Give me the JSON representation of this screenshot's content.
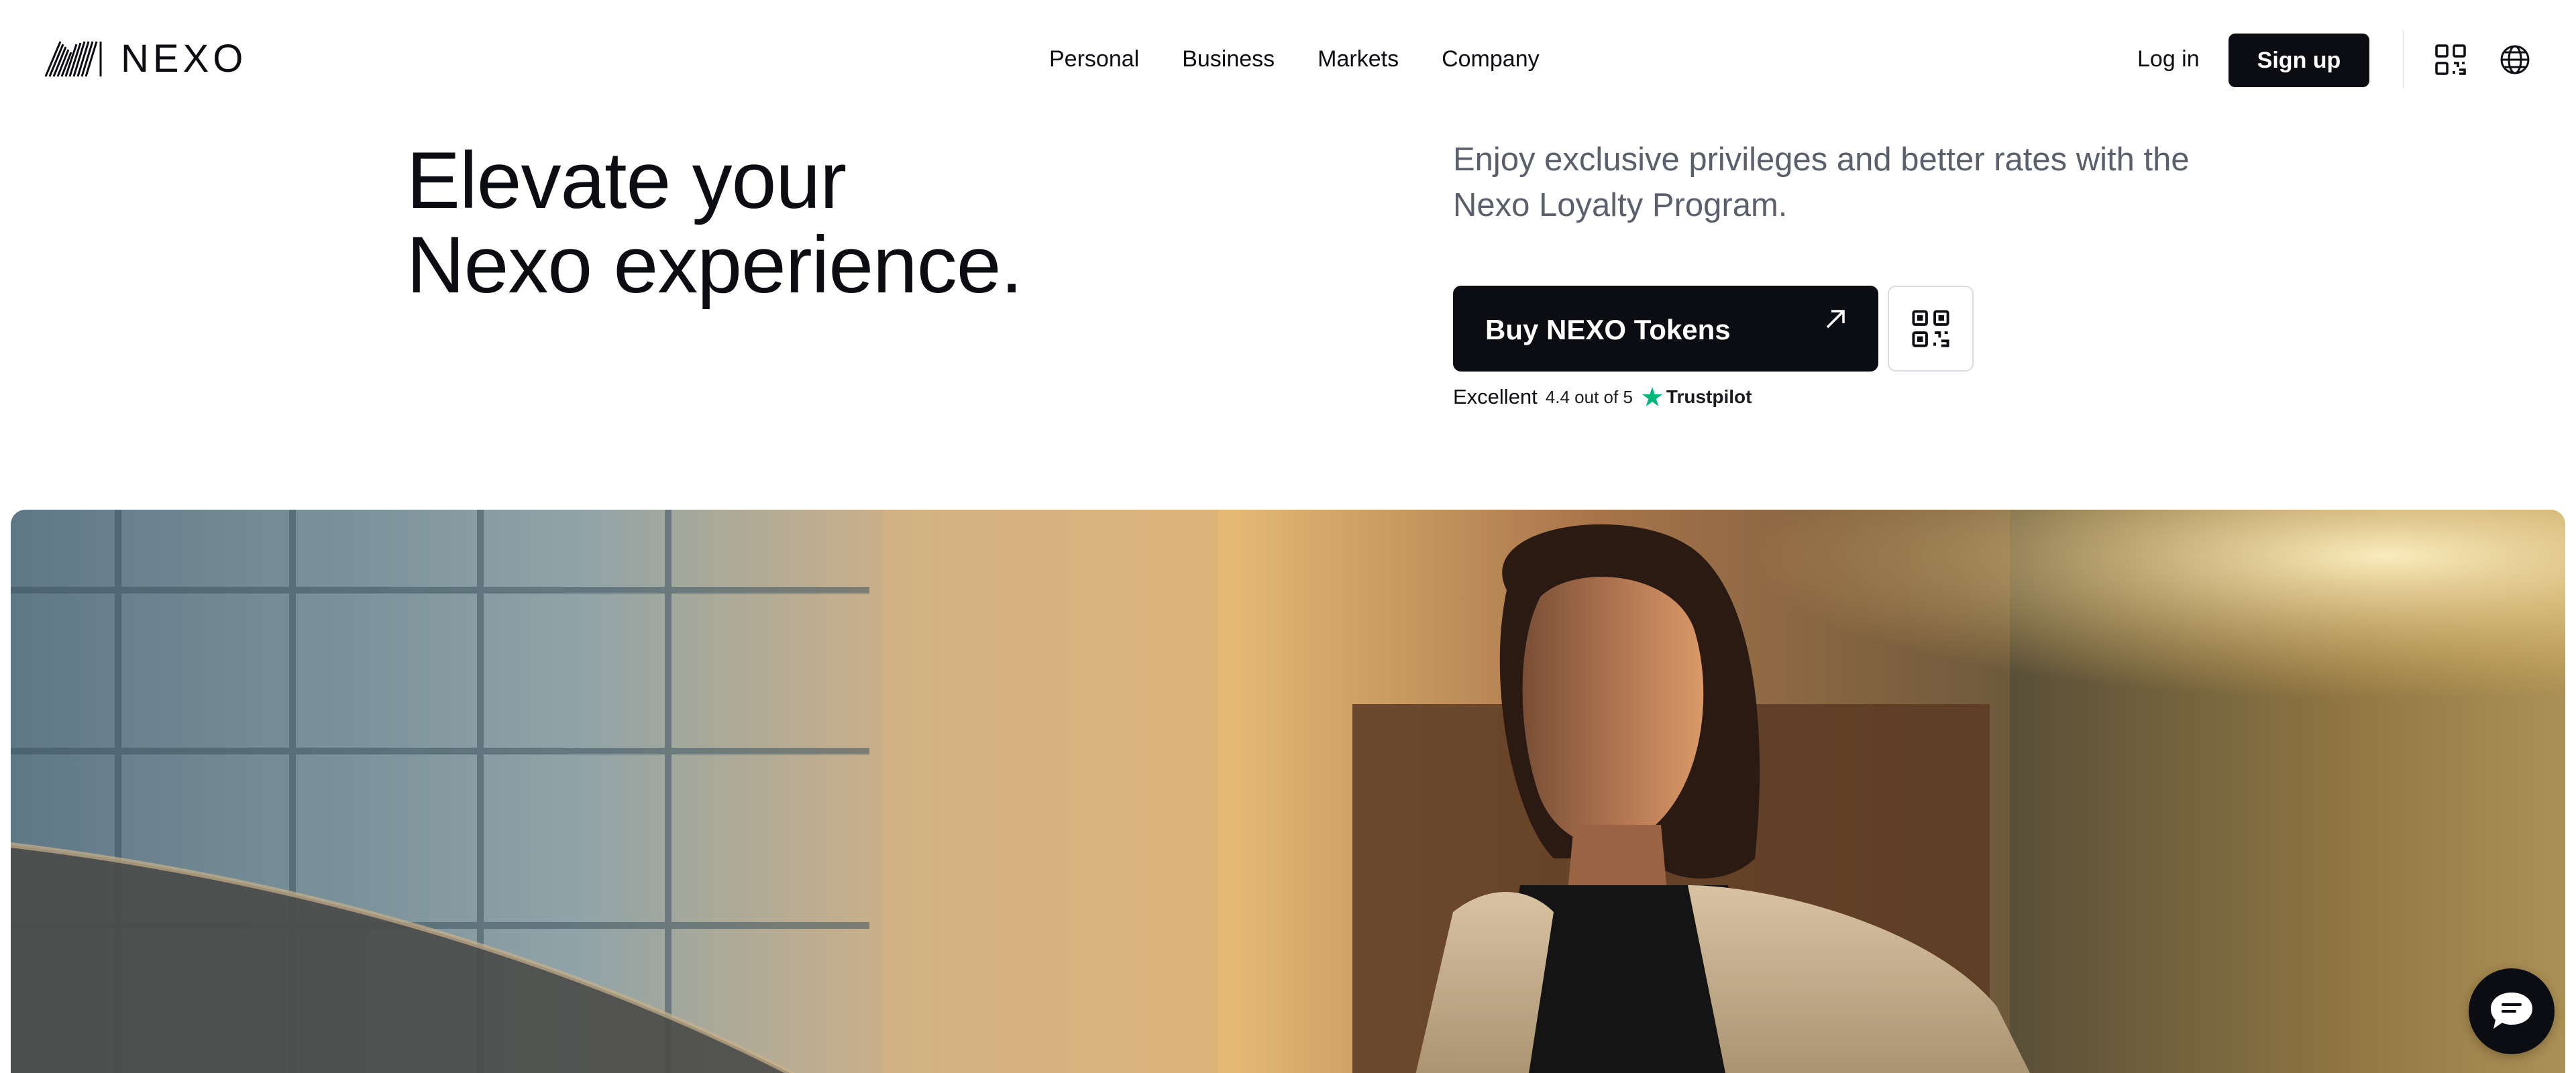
{
  "brand": {
    "name": "NEXO"
  },
  "nav": {
    "menu": [
      {
        "label": "Personal"
      },
      {
        "label": "Business"
      },
      {
        "label": "Markets"
      },
      {
        "label": "Company"
      }
    ],
    "login_label": "Log in",
    "signup_label": "Sign up",
    "qr_icon": "qr-code-icon",
    "language_icon": "globe-icon"
  },
  "hero": {
    "headline_line1": "Elevate your",
    "headline_line2": "Nexo experience.",
    "subtitle": "Enjoy exclusive privileges and better rates with the Nexo Loyalty Program.",
    "cta_label": "Buy NEXO Tokens",
    "cta_icon": "arrow-up-right-icon",
    "qr_icon": "qr-code-icon"
  },
  "rating": {
    "label": "Excellent",
    "score_text": "4.4 out of 5",
    "provider": "Trustpilot",
    "provider_color": "#00b67a"
  },
  "chat": {
    "icon": "chat-bubble-icon"
  },
  "colors": {
    "primary": "#0b0d12",
    "subtitle_text": "#5a5f6b",
    "background": "#ffffff"
  }
}
